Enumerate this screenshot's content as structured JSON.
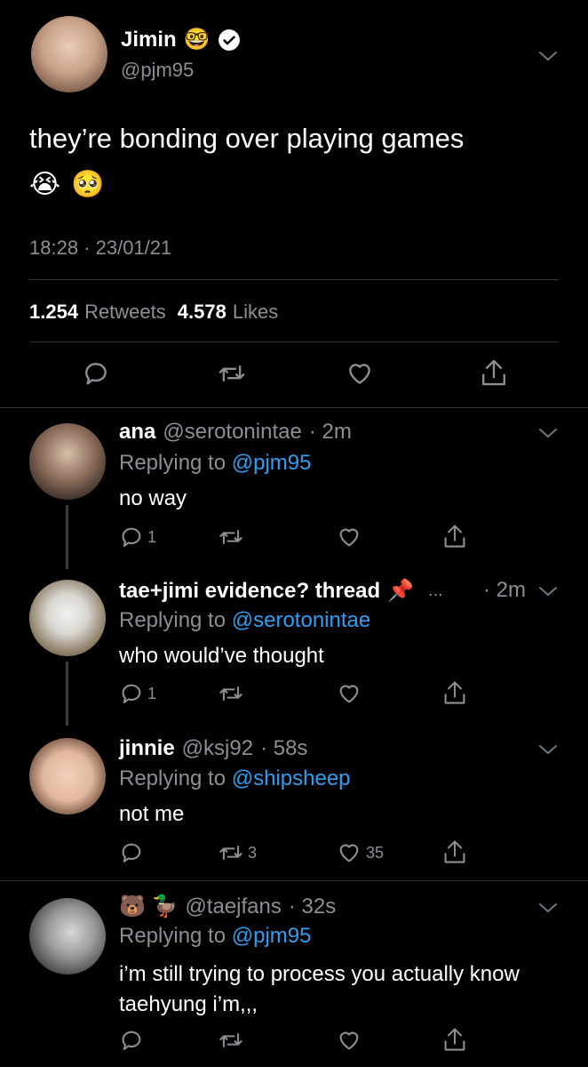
{
  "main_tweet": {
    "display_name": "Jimin",
    "name_emoji": "🤓",
    "handle": "@pjm95",
    "text": "they’re bonding over playing games",
    "emojis": "😭 🥺",
    "timestamp": "18:28 · 23/01/21",
    "retweets_count": "1.254",
    "retweets_label": "Retweets",
    "likes_count": "4.578",
    "likes_label": "Likes"
  },
  "replies": [
    {
      "name": "ana",
      "handle": "@serotonintae",
      "time": "· 2m",
      "replying_prefix": "Replying to",
      "replying_to": "@pjm95",
      "text": "no way",
      "reply_count": "1",
      "retweet_count": "",
      "like_count": ""
    },
    {
      "name": "tae+jimi evidence? thread",
      "name_emoji": "📌",
      "ellipsis": "...",
      "handle": "",
      "time": "· 2m",
      "replying_prefix": "Replying to",
      "replying_to": "@serotonintae",
      "text": "who would’ve thought",
      "reply_count": "1",
      "retweet_count": "",
      "like_count": ""
    },
    {
      "name": "jinnie",
      "handle": "@ksj92",
      "time": "· 58s",
      "replying_prefix": "Replying to",
      "replying_to": "@shipsheep",
      "text": "not me",
      "reply_count": "",
      "retweet_count": "3",
      "like_count": "35"
    },
    {
      "name_emoji": "🐻 🦆",
      "handle": "@taejfans",
      "time": "· 32s",
      "replying_prefix": "Replying to",
      "replying_to": "@pjm95",
      "text_line1": "i’m still trying to process you actually know",
      "text_line2": "taehyung i’m,,,",
      "reply_count": "",
      "retweet_count": "",
      "like_count": ""
    }
  ],
  "colors": {
    "background": "#000000",
    "secondary_text": "#8b8f94",
    "link": "#2f9ef2",
    "divider": "#2f3336"
  }
}
